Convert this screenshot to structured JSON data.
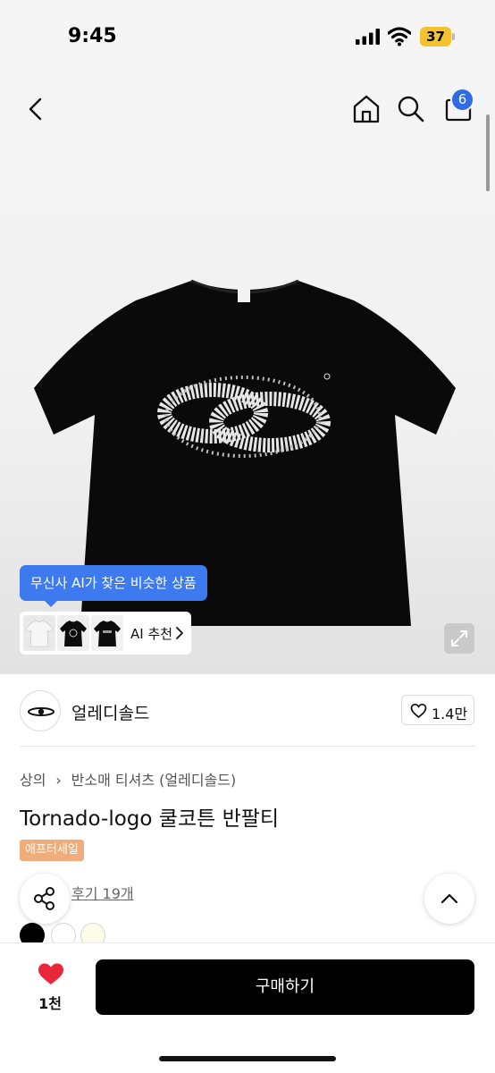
{
  "status_bar": {
    "time": "9:45",
    "battery": "37"
  },
  "header": {
    "cart_count": "6"
  },
  "ai": {
    "tooltip": "무신사 AI가 찾은 비슷한 상품",
    "recommend_label": "AI 추천"
  },
  "brand": {
    "name": "얼레디솔드",
    "like_count": "1.4만"
  },
  "breadcrumb": {
    "category": "상의",
    "subcategory": "반소매 티셔츠 (얼레디솔드)"
  },
  "product": {
    "title": "Tornado-logo 쿨코튼 반팔티",
    "sale_badge": "애프터세일",
    "reviews": "후기 19개",
    "swatches": [
      "#000000",
      "#ffffff",
      "#fdfbe9"
    ]
  },
  "bottom": {
    "wish_count": "1천",
    "buy_label": "구매하기"
  },
  "colors": {
    "accent": "#3d7af0",
    "badge": "#2f6be8",
    "sale": "#f0ad7c",
    "heart": "#e8283a"
  }
}
